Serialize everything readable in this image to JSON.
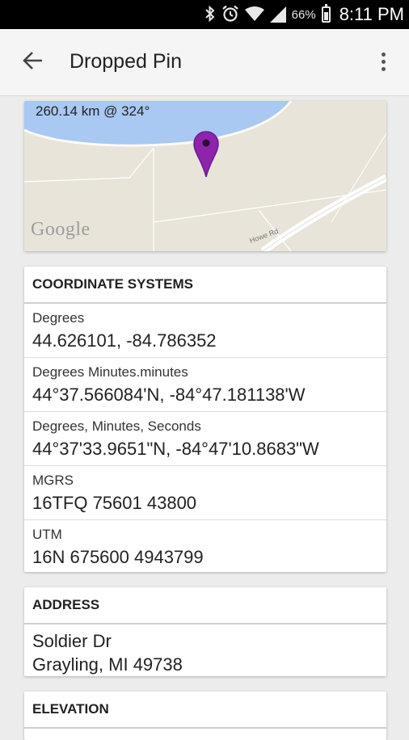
{
  "status_bar": {
    "battery_percent": "66%",
    "time": "8:11 PM",
    "icons": [
      "bluetooth-icon",
      "alarm-icon",
      "wifi-icon",
      "signal-icon",
      "battery-icon"
    ]
  },
  "app_bar": {
    "title": "Dropped Pin",
    "back_icon": "arrow-left-icon",
    "menu_icon": "more-vert-icon"
  },
  "map": {
    "distance_text": "260.14 km @ 324°",
    "logo_text": "Google",
    "road_label": "Howe Rd",
    "pin_color": "#7b1fa2"
  },
  "coordinate_systems": {
    "header": "COORDINATE SYSTEMS",
    "rows": [
      {
        "label": "Degrees",
        "value": "44.626101, -84.786352"
      },
      {
        "label": "Degrees Minutes.minutes",
        "value": "44°37.566084'N, -84°47.181138'W"
      },
      {
        "label": "Degrees, Minutes, Seconds",
        "value": "44°37'33.9651\"N, -84°47'10.8683\"W"
      },
      {
        "label": "MGRS",
        "value": "16TFQ 75601 43800"
      },
      {
        "label": "UTM",
        "value": "16N 675600 4943799"
      }
    ]
  },
  "address": {
    "header": "ADDRESS",
    "line1": "Soldier Dr",
    "line2": "Grayling, MI 49738"
  },
  "elevation": {
    "header": "ELEVATION"
  }
}
